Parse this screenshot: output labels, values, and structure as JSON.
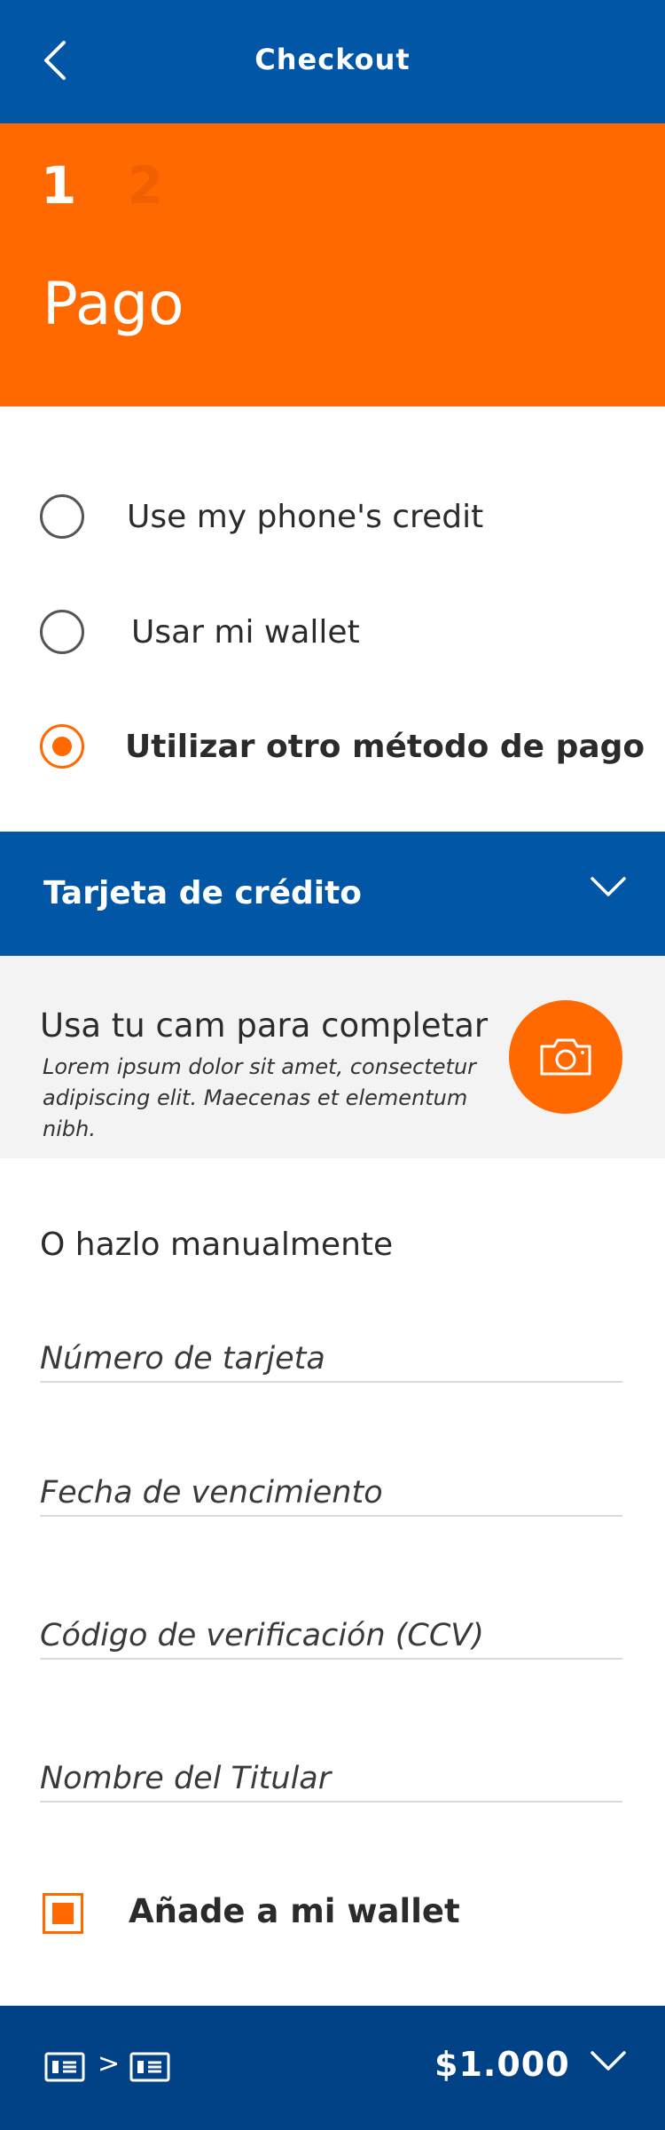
{
  "header": {
    "title": "Checkout",
    "back_icon": "chevron-left-icon"
  },
  "steps": {
    "current": "1",
    "next": "2",
    "title": "Pago"
  },
  "payment_options": [
    {
      "label": "Use my phone's credit",
      "selected": false
    },
    {
      "label": "Usar mi wallet",
      "selected": false
    },
    {
      "label": "Utilizar otro método de pago",
      "selected": true
    }
  ],
  "card_type": {
    "label": "Tarjeta de crédito",
    "icon": "chevron-down-icon"
  },
  "camera": {
    "title": "Usa tu cam para completar",
    "description": "Lorem ipsum dolor sit amet, consectetur adipiscing elit. Maecenas et elementum nibh.",
    "icon": "camera-icon"
  },
  "manual": {
    "title": "O hazlo manualmente",
    "fields": {
      "card_number": {
        "placeholder": "Número de tarjeta",
        "value": ""
      },
      "expiry": {
        "placeholder": "Fecha de vencimiento",
        "value": ""
      },
      "cvv": {
        "placeholder": "Código de verificación (CCV)",
        "value": ""
      },
      "holder": {
        "placeholder": "Nombre del Titular",
        "value": ""
      }
    }
  },
  "wallet_option": {
    "label": "Añade a mi wallet",
    "checked": true
  },
  "footer": {
    "separator": ">",
    "total": "$1.000",
    "card_icon": "credit-card-icon",
    "expand_icon": "chevron-down-icon"
  },
  "colors": {
    "primary_blue": "#0156a5",
    "footer_blue": "#004285",
    "accent_orange": "#ff6900",
    "panel_gray": "#f3f3f3"
  }
}
